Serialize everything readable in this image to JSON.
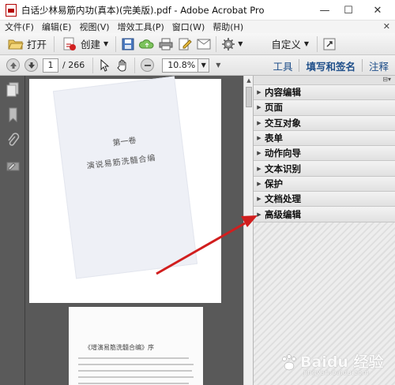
{
  "window": {
    "title": "白话少林易筋内功(真本)(完美版).pdf - Adobe Acrobat Pro",
    "minimize": "—",
    "maximize": "☐",
    "close": "✕"
  },
  "menu": {
    "items": [
      "文件(F)",
      "编辑(E)",
      "视图(V)",
      "增效工具(P)",
      "窗口(W)",
      "帮助(H)"
    ],
    "close": "✕"
  },
  "toolbar": {
    "open": "打开",
    "create": "创建",
    "customize": "自定义"
  },
  "nav": {
    "page_current": "1",
    "page_total": "/ 266",
    "zoom": "10.8%",
    "links": [
      "工具",
      "填写和签名",
      "注释"
    ]
  },
  "tools_panel": {
    "items": [
      "内容编辑",
      "页面",
      "交互对象",
      "表单",
      "动作向导",
      "文本识别",
      "保护",
      "文档处理",
      "高级编辑"
    ]
  },
  "document": {
    "page1_title": "第一卷",
    "page1_subtitle": "演说易筋洗髓合编",
    "page2_title": "《增演易筋洗髓合编》序"
  },
  "watermark": {
    "text": "Baidu 经验",
    "sub": "jingyan.baidu.com"
  },
  "colors": {
    "arrow": "#d11e1e",
    "nav_bg": "#5a5a5a",
    "link": "#1f4f8a"
  }
}
